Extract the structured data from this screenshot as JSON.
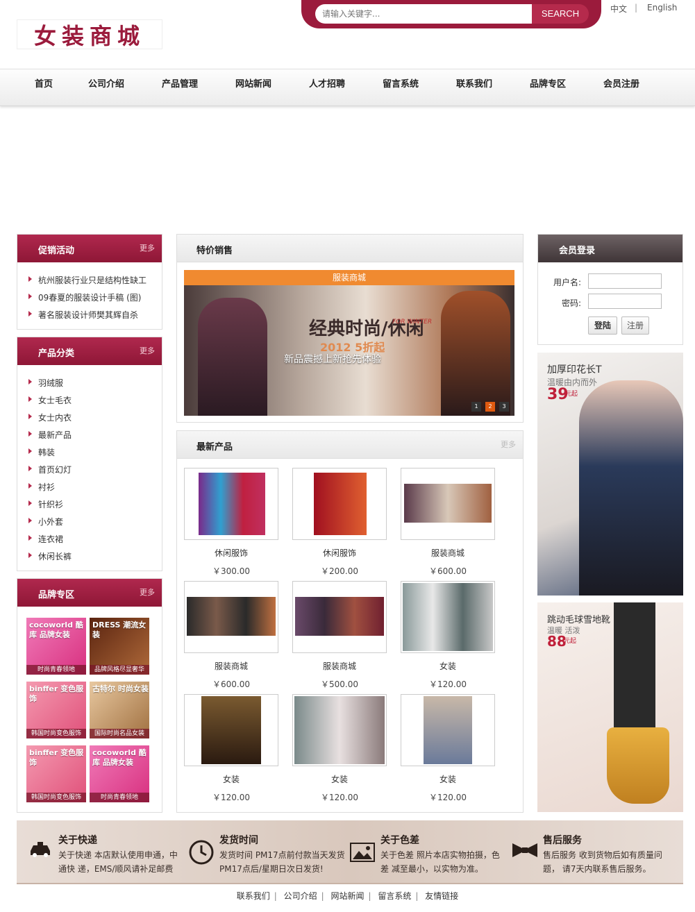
{
  "header": {
    "logo_text": "女装商城",
    "search": {
      "placeholder": "请输入关键字...",
      "button": "SEARCH"
    },
    "lang": {
      "cn": "中文",
      "sep": "|",
      "en": "English"
    }
  },
  "nav": [
    "首页",
    "公司介绍",
    "产品管理",
    "网站新闻",
    "人才招聘",
    "留言系统",
    "联系我们",
    "品牌专区",
    "会员注册"
  ],
  "promo": {
    "title": "促销活动",
    "more": "更多",
    "items": [
      "杭州服装行业只是结构性缺工",
      "09春夏的服装设计手稿 (图)",
      "著名服装设计师樊其辉自杀"
    ]
  },
  "categories": {
    "title": "产品分类",
    "more": "更多",
    "items": [
      "羽绒服",
      "女士毛衣",
      "女士内衣",
      "最新产品",
      "韩装",
      "首页幻灯",
      "衬衫",
      "针织衫",
      "小外套",
      "连衣裙",
      "休闲长裤"
    ]
  },
  "brands": {
    "title": "品牌专区",
    "more": "更多",
    "items": [
      {
        "title": "cocoworld 酷库 品牌女装",
        "caption": "时尚青春领地",
        "color": "#e04a9a"
      },
      {
        "title": "DRESS 潮流女装",
        "caption": "品牌风格尽显奢华",
        "color": "#7a3a1e"
      },
      {
        "title": "binffer 变色服饰",
        "caption": "韩国时尚变色服饰",
        "color": "#e76a8a"
      },
      {
        "title": "古特尔 时尚女装",
        "caption": "国际时尚名品女装",
        "color": "#c8a070"
      },
      {
        "title": "binffer 变色服饰",
        "caption": "韩国时尚变色服饰",
        "color": "#e76a8a"
      },
      {
        "title": "cocoworld 酷库 品牌女装",
        "caption": "时尚青春领地",
        "color": "#e04a9a"
      }
    ]
  },
  "special": {
    "title": "特价销售",
    "banner": {
      "top_label": "服装商城",
      "headline": "经典时尚/休闲",
      "tag": "FOR WINTER",
      "sub": "2012 5折起",
      "slogan": "新品震撼上新抢先体验",
      "pages": [
        "1",
        "2",
        "3"
      ],
      "active_page": 1
    }
  },
  "latest": {
    "title": "最新产品",
    "more": "更多",
    "products": [
      {
        "name": "休闲服饰",
        "price": "￥300.00"
      },
      {
        "name": "休闲服饰",
        "price": "￥200.00"
      },
      {
        "name": "服装商城",
        "price": "￥600.00"
      },
      {
        "name": "服装商城",
        "price": "￥600.00"
      },
      {
        "name": "服装商城",
        "price": "￥500.00"
      },
      {
        "name": "女装",
        "price": "￥120.00"
      },
      {
        "name": "女装",
        "price": "￥120.00"
      },
      {
        "name": "女装",
        "price": "￥120.00"
      },
      {
        "name": "女装",
        "price": "￥120.00"
      }
    ]
  },
  "login": {
    "title": "会员登录",
    "username_label": "用户名:",
    "password_label": "密码:",
    "login_button": "登陆",
    "register_button": "注册"
  },
  "ads": [
    {
      "title": "加厚印花长T",
      "sub": "温暖由内而外",
      "price": "39",
      "unit": "元起"
    },
    {
      "title": "跳动毛球雪地靴",
      "sub": "温暖 活泼",
      "price": "88",
      "unit": "元起"
    }
  ],
  "services": [
    {
      "title": "关于快递",
      "desc": "关于快递 本店默认使用申通，中通快 递，EMS/顺风请补足邮费",
      "icon": "car-icon"
    },
    {
      "title": "发货时间",
      "desc": "发货时间 PM17点前付款当天发货 PM17点后/星期日次日发货!",
      "icon": "clock-icon"
    },
    {
      "title": "关于色差",
      "desc": "关于色差 照片本店实物拍摄，色差 减至最小，以实物为准。",
      "icon": "image-icon"
    },
    {
      "title": "售后服务",
      "desc": "售后服务 收到货物后如有质量问题， 请7天内联系售后服务。",
      "icon": "bowtie-icon"
    }
  ],
  "footer": [
    "联系我们",
    "公司介绍",
    "网站新闻",
    "留言系统",
    "友情链接"
  ],
  "colors": {
    "brand": "#9b1b3c",
    "login_head": "#4f4547"
  }
}
